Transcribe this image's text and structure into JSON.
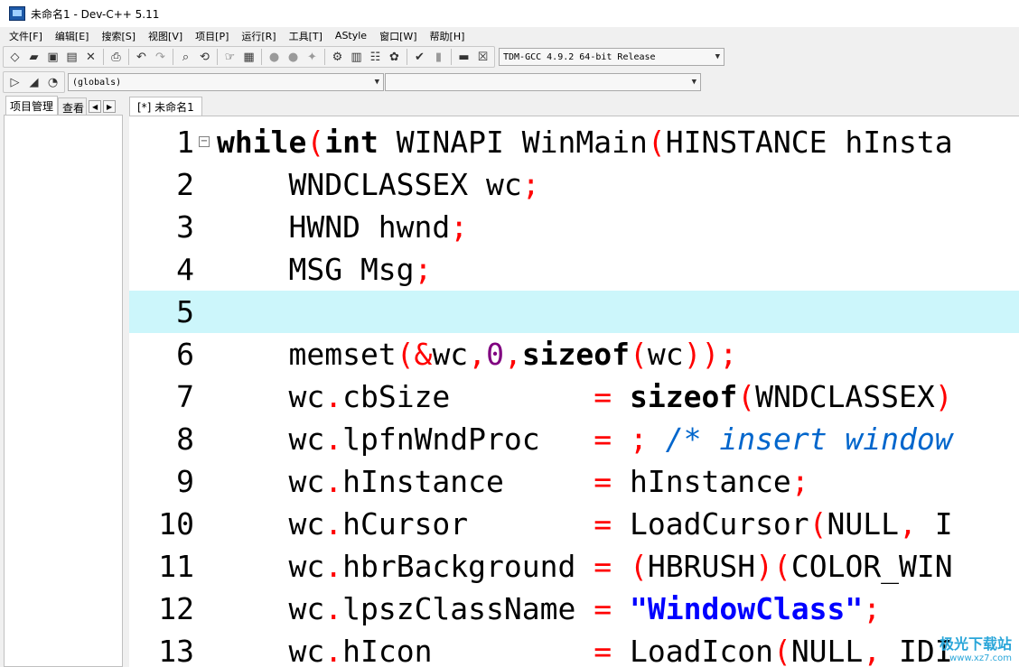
{
  "window": {
    "title": "未命名1 - Dev-C++ 5.11"
  },
  "menu": [
    "文件[F]",
    "编辑[E]",
    "搜索[S]",
    "视图[V]",
    "项目[P]",
    "运行[R]",
    "工具[T]",
    "AStyle",
    "窗口[W]",
    "帮助[H]"
  ],
  "toolbar": {
    "compiler": "TDM-GCC 4.9.2 64-bit Release",
    "scope": "(globals)",
    "function": ""
  },
  "left_tabs": [
    "项目管理",
    "查看"
  ],
  "editor_tab": "[*] 未命名1",
  "code_lines": [
    [
      {
        "c": "kw",
        "t": "while"
      },
      {
        "c": "sym",
        "t": "("
      },
      {
        "c": "kw",
        "t": "int"
      },
      {
        "c": "plain",
        "t": " WINAPI WinMain"
      },
      {
        "c": "sym",
        "t": "("
      },
      {
        "c": "plain",
        "t": "HINSTANCE hInsta"
      }
    ],
    [
      {
        "c": "plain",
        "t": "    WNDCLASSEX wc"
      },
      {
        "c": "sym",
        "t": ";"
      }
    ],
    [
      {
        "c": "plain",
        "t": "    HWND hwnd"
      },
      {
        "c": "sym",
        "t": ";"
      }
    ],
    [
      {
        "c": "plain",
        "t": "    MSG Msg"
      },
      {
        "c": "sym",
        "t": ";"
      }
    ],
    [],
    [
      {
        "c": "plain",
        "t": "    memset"
      },
      {
        "c": "sym",
        "t": "(&"
      },
      {
        "c": "plain",
        "t": "wc"
      },
      {
        "c": "sym",
        "t": ","
      },
      {
        "c": "num",
        "t": "0"
      },
      {
        "c": "sym",
        "t": ","
      },
      {
        "c": "kw",
        "t": "sizeof"
      },
      {
        "c": "sym",
        "t": "("
      },
      {
        "c": "plain",
        "t": "wc"
      },
      {
        "c": "sym",
        "t": "));"
      }
    ],
    [
      {
        "c": "plain",
        "t": "    wc"
      },
      {
        "c": "sym",
        "t": "."
      },
      {
        "c": "plain",
        "t": "cbSize        "
      },
      {
        "c": "sym",
        "t": "="
      },
      {
        "c": "plain",
        "t": " "
      },
      {
        "c": "kw",
        "t": "sizeof"
      },
      {
        "c": "sym",
        "t": "("
      },
      {
        "c": "plain",
        "t": "WNDCLASSEX"
      },
      {
        "c": "sym",
        "t": ")"
      }
    ],
    [
      {
        "c": "plain",
        "t": "    wc"
      },
      {
        "c": "sym",
        "t": "."
      },
      {
        "c": "plain",
        "t": "lpfnWndProc   "
      },
      {
        "c": "sym",
        "t": "="
      },
      {
        "c": "plain",
        "t": " "
      },
      {
        "c": "sym",
        "t": ";"
      },
      {
        "c": "plain",
        "t": " "
      },
      {
        "c": "cmt",
        "t": "/* insert window"
      }
    ],
    [
      {
        "c": "plain",
        "t": "    wc"
      },
      {
        "c": "sym",
        "t": "."
      },
      {
        "c": "plain",
        "t": "hInstance     "
      },
      {
        "c": "sym",
        "t": "="
      },
      {
        "c": "plain",
        "t": " hInstance"
      },
      {
        "c": "sym",
        "t": ";"
      }
    ],
    [
      {
        "c": "plain",
        "t": "    wc"
      },
      {
        "c": "sym",
        "t": "."
      },
      {
        "c": "plain",
        "t": "hCursor       "
      },
      {
        "c": "sym",
        "t": "="
      },
      {
        "c": "plain",
        "t": " LoadCursor"
      },
      {
        "c": "sym",
        "t": "("
      },
      {
        "c": "plain",
        "t": "NULL"
      },
      {
        "c": "sym",
        "t": ","
      },
      {
        "c": "plain",
        "t": " I"
      }
    ],
    [
      {
        "c": "plain",
        "t": "    wc"
      },
      {
        "c": "sym",
        "t": "."
      },
      {
        "c": "plain",
        "t": "hbrBackground "
      },
      {
        "c": "sym",
        "t": "="
      },
      {
        "c": "plain",
        "t": " "
      },
      {
        "c": "sym",
        "t": "("
      },
      {
        "c": "plain",
        "t": "HBRUSH"
      },
      {
        "c": "sym",
        "t": ")("
      },
      {
        "c": "plain",
        "t": "COLOR_WIN"
      }
    ],
    [
      {
        "c": "plain",
        "t": "    wc"
      },
      {
        "c": "sym",
        "t": "."
      },
      {
        "c": "plain",
        "t": "lpszClassName "
      },
      {
        "c": "sym",
        "t": "="
      },
      {
        "c": "plain",
        "t": " "
      },
      {
        "c": "str",
        "t": "\"WindowClass\""
      },
      {
        "c": "sym",
        "t": ";"
      }
    ],
    [
      {
        "c": "plain",
        "t": "    wc"
      },
      {
        "c": "sym",
        "t": "."
      },
      {
        "c": "plain",
        "t": "hIcon         "
      },
      {
        "c": "sym",
        "t": "="
      },
      {
        "c": "plain",
        "t": " LoadIcon"
      },
      {
        "c": "sym",
        "t": "("
      },
      {
        "c": "plain",
        "t": "NULL"
      },
      {
        "c": "sym",
        "t": ","
      },
      {
        "c": "plain",
        "t": " IDI"
      }
    ]
  ],
  "highlight_line": 5,
  "watermark": {
    "title": "极光下载站",
    "url": "www.xz7.com"
  }
}
